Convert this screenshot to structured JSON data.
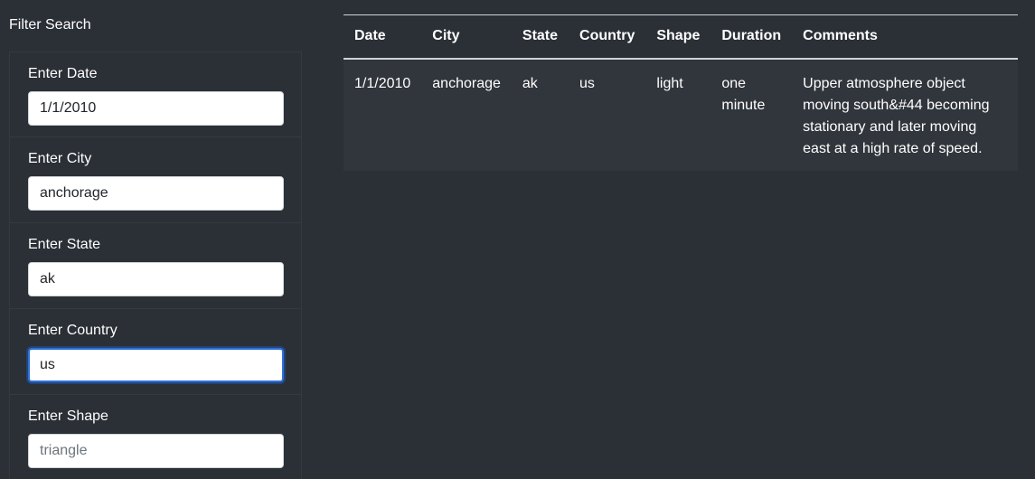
{
  "sidebar": {
    "title": "Filter Search",
    "filters": [
      {
        "label": "Enter Date",
        "value": "1/1/2010",
        "placeholder": ""
      },
      {
        "label": "Enter City",
        "value": "anchorage",
        "placeholder": ""
      },
      {
        "label": "Enter State",
        "value": "ak",
        "placeholder": ""
      },
      {
        "label": "Enter Country",
        "value": "us",
        "placeholder": ""
      },
      {
        "label": "Enter Shape",
        "value": "",
        "placeholder": "triangle"
      }
    ]
  },
  "table": {
    "headers": [
      "Date",
      "City",
      "State",
      "Country",
      "Shape",
      "Duration",
      "Comments"
    ],
    "rows": [
      [
        "1/1/2010",
        "anchorage",
        "ak",
        "us",
        "light",
        "one minute",
        "Upper atmosphere object moving south&#44 becoming stationary and later moving east at a high rate of speed."
      ]
    ]
  },
  "colors": {
    "background": "#2b2f36",
    "row_background": "#31353c",
    "focus_border": "#2f6fd6"
  }
}
